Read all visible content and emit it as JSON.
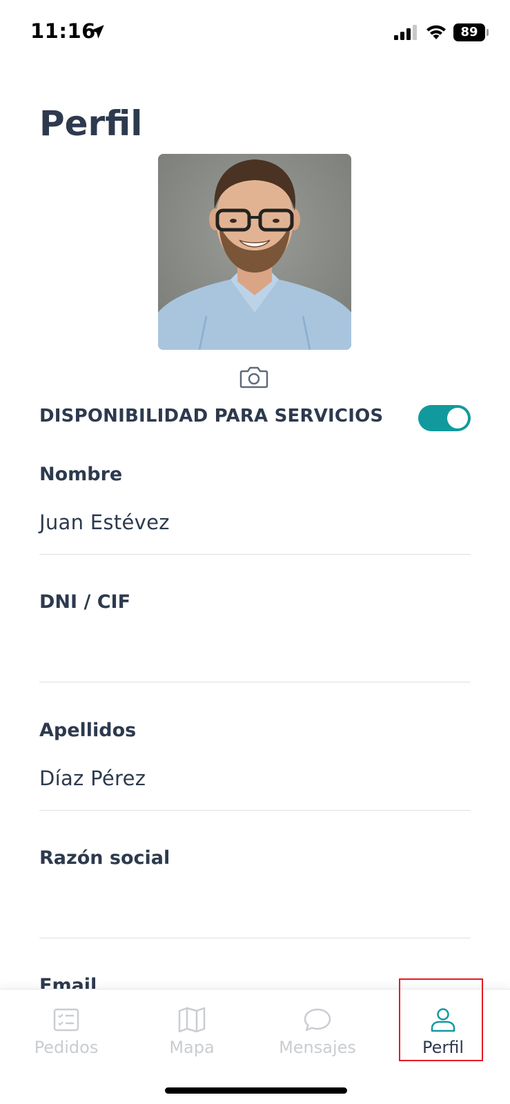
{
  "status_bar": {
    "time": "11:16",
    "battery_level": "89",
    "icons": [
      "location-arrow-icon",
      "cellular-signal-icon",
      "wifi-icon",
      "battery-icon"
    ]
  },
  "page": {
    "title": "Perfil"
  },
  "profile": {
    "photo_icon": "person-photo",
    "camera_icon": "camera-icon"
  },
  "availability": {
    "label": "DISPONIBILIDAD PARA SERVICIOS",
    "enabled": true,
    "toggle_color": "#11999e"
  },
  "fields": [
    {
      "label": "Nombre",
      "value": "Juan Estévez"
    },
    {
      "label": "DNI / CIF",
      "value": ""
    },
    {
      "label": "Apellidos",
      "value": "Díaz Pérez"
    },
    {
      "label": "Razón social",
      "value": ""
    },
    {
      "label": "Email",
      "value": ""
    }
  ],
  "nav": {
    "items": [
      {
        "label": "Pedidos",
        "icon": "order-list-icon",
        "active": false
      },
      {
        "label": "Mapa",
        "icon": "map-icon",
        "active": false
      },
      {
        "label": "Mensajes",
        "icon": "chat-bubble-icon",
        "active": false
      },
      {
        "label": "Perfil",
        "icon": "user-icon",
        "active": true
      }
    ],
    "active_color": "#11999e",
    "inactive_color": "#c9cdd2"
  }
}
